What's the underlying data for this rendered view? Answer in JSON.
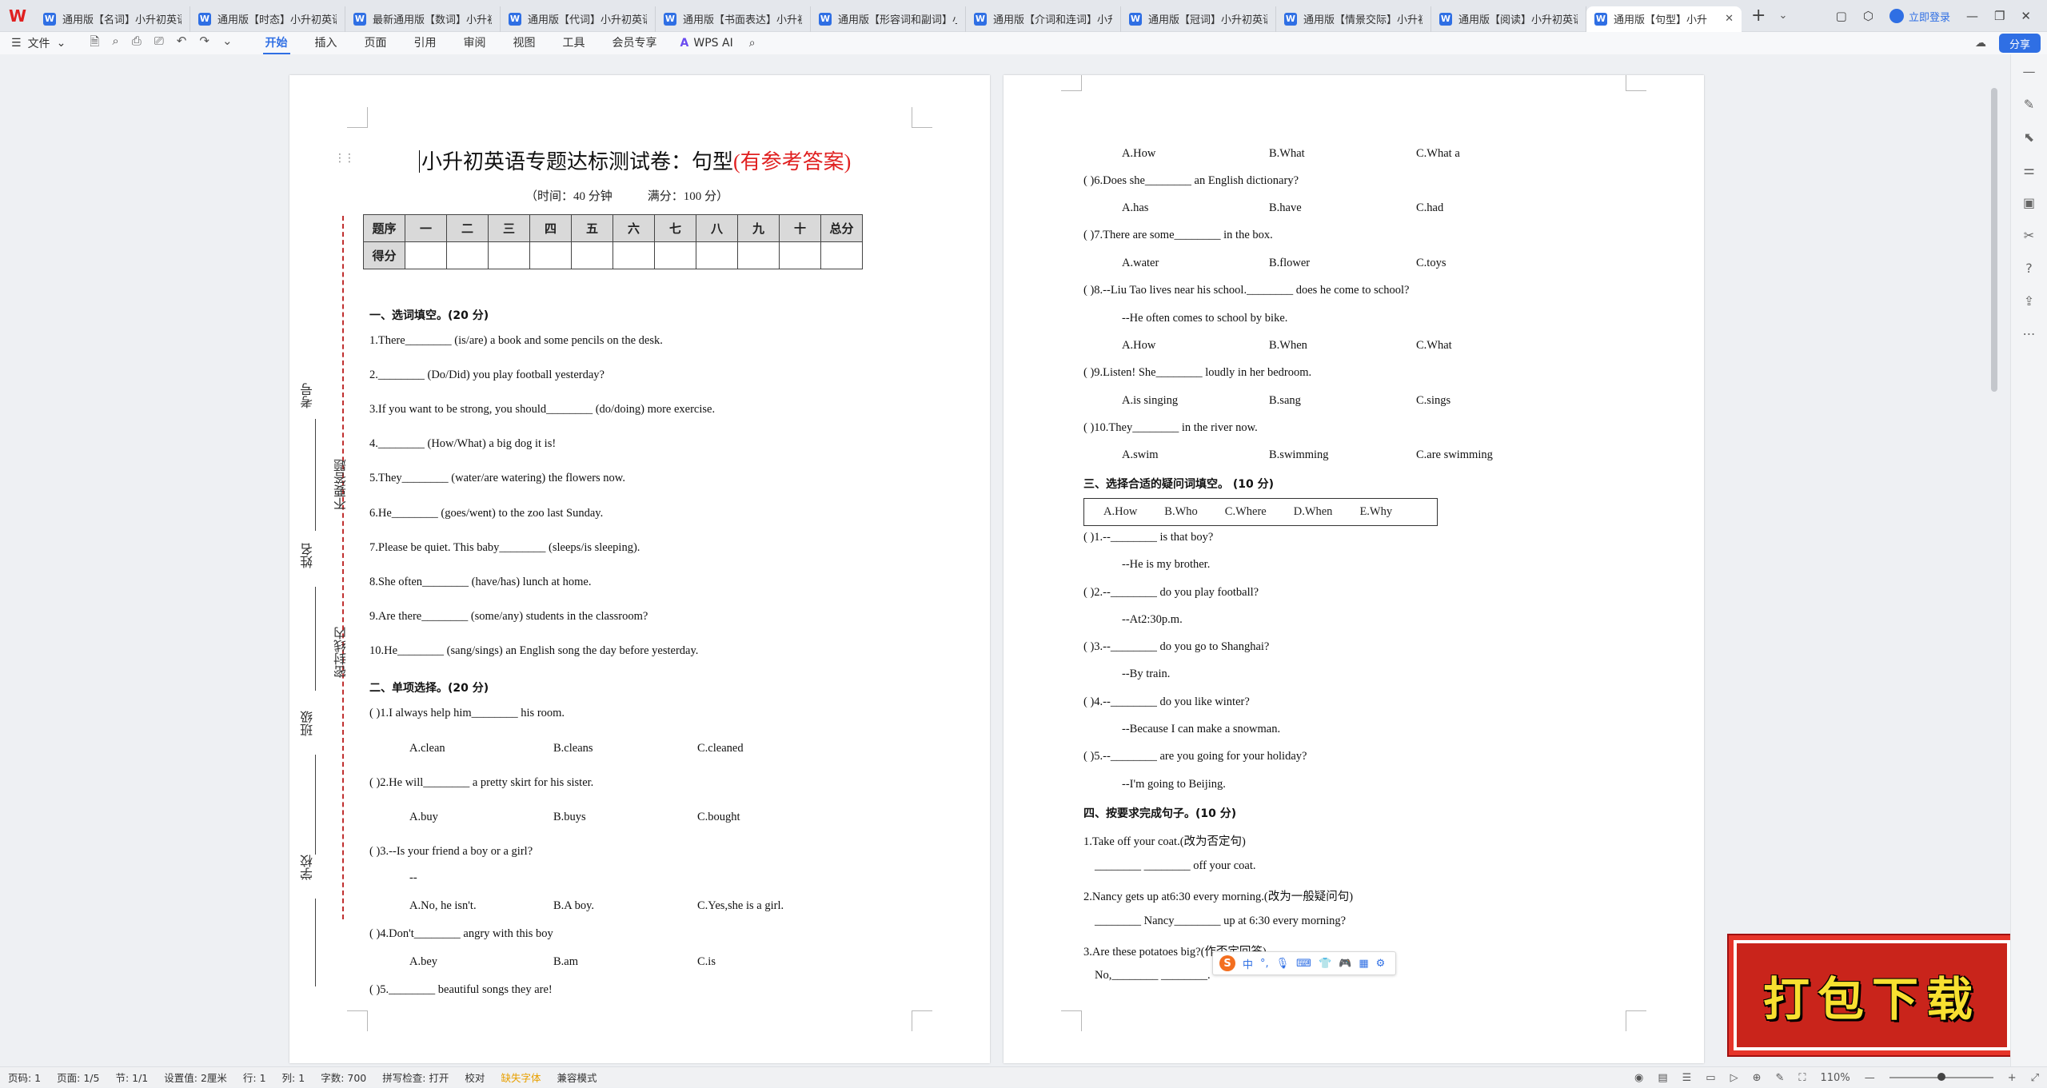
{
  "tabs": [
    {
      "title": "通用版【名词】小升初英语专"
    },
    {
      "title": "通用版【时态】小升初英语专"
    },
    {
      "title": "最新通用版【数词】小升初"
    },
    {
      "title": "通用版【代词】小升初英语"
    },
    {
      "title": "通用版【书面表达】小升初"
    },
    {
      "title": "通用版【形容词和副词】小"
    },
    {
      "title": "通用版【介词和连词】小升"
    },
    {
      "title": "通用版【冠词】小升初英语专"
    },
    {
      "title": "通用版【情景交际】小升初"
    },
    {
      "title": "通用版【阅读】小升初英语"
    },
    {
      "title": "通用版【句型】小升"
    }
  ],
  "login_label": "立即登录",
  "ribbon": {
    "file": "文件",
    "menus": [
      "开始",
      "插入",
      "页面",
      "引用",
      "审阅",
      "视图",
      "工具",
      "会员专享"
    ],
    "wps_ai": "WPS AI",
    "share": "分享"
  },
  "doc": {
    "title_main": "小升初英语专题达标测试卷：句型",
    "title_note": "(有参考答案)",
    "time": "（时间：40 分钟",
    "score": "满分：100 分）",
    "table_header": [
      "题序",
      "一",
      "二",
      "三",
      "四",
      "五",
      "六",
      "七",
      "八",
      "九",
      "十",
      "总分"
    ],
    "table_row2": "得分",
    "side_labels": [
      "考号",
      "不要答题",
      "姓名",
      "密封线内",
      "班级",
      "学校"
    ]
  },
  "page1_lines": [
    {
      "t": "一、选词填空。(20 分)",
      "h": true
    },
    {
      "t": "1.There________ (is/are) a book and some pencils on the desk."
    },
    {
      "t": "2.________ (Do/Did) you play football yesterday?"
    },
    {
      "t": "3.If you want to be strong, you should________ (do/doing) more exercise."
    },
    {
      "t": "4.________ (How/What) a big dog it is!"
    },
    {
      "t": "5.They________ (water/are watering) the flowers now."
    },
    {
      "t": "6.He________ (goes/went) to the zoo last Sunday."
    },
    {
      "t": "7.Please be quiet. This baby________ (sleeps/is sleeping)."
    },
    {
      "t": "8.She often________ (have/has) lunch at home."
    },
    {
      "t": "9.Are there________ (some/any) students in the classroom?"
    },
    {
      "t": "10.He________ (sang/sings) an English song the day before yesterday."
    },
    {
      "t": "二、单项选择。(20 分)",
      "h": true
    },
    {
      "t": "(      )1.I always help him________ his room."
    },
    {
      "o": [
        "A.clean",
        "B.cleans",
        "C.cleaned"
      ]
    },
    {
      "t": "(      )2.He will________ a pretty skirt for his sister."
    },
    {
      "o": [
        "A.buy",
        "B.buys",
        "C.bought"
      ]
    },
    {
      "t": "(      )3.--Is your friend a boy or a girl?"
    },
    {
      "o": [
        "--"
      ]
    },
    {
      "o": [
        "A.No, he isn't.",
        "B.A boy.",
        "C.Yes,she is a girl."
      ]
    },
    {
      "t": "(      )4.Don't________ angry with this boy"
    },
    {
      "o": [
        "A.bey",
        "B.am",
        "C.is"
      ]
    },
    {
      "t": "(      )5.________ beautiful songs they are!"
    }
  ],
  "page2_lines": [
    {
      "o": [
        "A.How",
        "B.What",
        "C.What a"
      ]
    },
    {
      "t": "(      )6.Does she________ an English dictionary?"
    },
    {
      "o": [
        "A.has",
        "B.have",
        "C.had"
      ]
    },
    {
      "t": "(      )7.There are some________ in the box."
    },
    {
      "o": [
        "A.water",
        "B.flower",
        "C.toys"
      ]
    },
    {
      "t": "(      )8.--Liu Tao lives near his school.________ does he come to school?"
    },
    {
      "t": "--He often comes to school by bike.",
      "ind": true
    },
    {
      "o": [
        "A.How",
        "B.When",
        "C.What"
      ]
    },
    {
      "t": "(      )9.Listen! She________ loudly in her bedroom."
    },
    {
      "o": [
        "A.is singing",
        "B.sang",
        "C.sings"
      ]
    },
    {
      "t": "(      )10.They________ in the river now."
    },
    {
      "o": [
        "A.swim",
        "B.swimming",
        "C.are swimming"
      ]
    },
    {
      "t": "三、选择合适的疑问词填空。 (10 分)",
      "h": true
    },
    {
      "box": true
    },
    {
      "t": "(      )1.--________ is that boy?"
    },
    {
      "t": "--He is my brother.",
      "ind": true
    },
    {
      "t": "(      )2.--________ do you play football?"
    },
    {
      "t": "--At2:30p.m.",
      "ind": true
    },
    {
      "t": "(      )3.--________ do you go to Shanghai?"
    },
    {
      "t": "--By train.",
      "ind": true
    },
    {
      "t": "(      )4.--________ do you like winter?"
    },
    {
      "t": "--Because I can make a snowman.",
      "ind": true
    },
    {
      "t": "(      )5.--________ are you going for your holiday?"
    },
    {
      "t": "--I'm going to Beijing.",
      "ind": true
    },
    {
      "t": "四、按要求完成句子。(10 分)",
      "h": true
    },
    {
      "t": "1.Take off your coat.(改为否定句)"
    },
    {
      "t": "________ ________ off your coat.",
      "ind2": true
    },
    {
      "t": "2.Nancy gets up at6:30 every morning.(改为一般疑问句)"
    },
    {
      "t": "________ Nancy________ up at 6:30 every morning?",
      "ind2": true
    },
    {
      "t": "3.Are these potatoes big?(作否定回答)"
    },
    {
      "t": "No,________ ________.",
      "ind2": true
    }
  ],
  "word_box": [
    "A.How",
    "B.Who",
    "C.Where",
    "D.When",
    "E.Why"
  ],
  "banner": "打包下载",
  "ime": {
    "logo": "S",
    "lang": "中"
  },
  "status": {
    "items": [
      "页码: 1",
      "页面: 1/5",
      "节: 1/1",
      "设置值: 2厘米",
      "行: 1",
      "列: 1",
      "字数: 700",
      "拼写检查: 打开",
      "校对",
      "缺失字体",
      "兼容模式"
    ],
    "zoom": "110%"
  }
}
